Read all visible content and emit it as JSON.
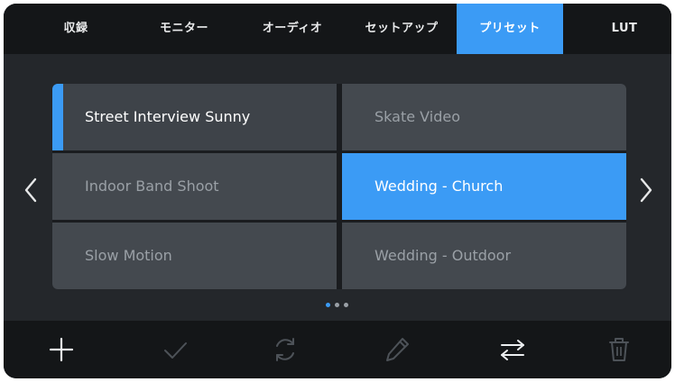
{
  "tabs": [
    {
      "label": "収録"
    },
    {
      "label": "モニター"
    },
    {
      "label": "オーディオ"
    },
    {
      "label": "セットアップ"
    },
    {
      "label": "プリセット"
    },
    {
      "label": "LUT"
    }
  ],
  "active_tab": "プリセット",
  "presets": [
    {
      "name": "Street Interview Sunny"
    },
    {
      "name": "Skate Video"
    },
    {
      "name": "Indoor Band Shoot"
    },
    {
      "name": "Wedding - Church"
    },
    {
      "name": "Slow Motion"
    },
    {
      "name": "Wedding - Outdoor"
    }
  ],
  "pagination": {
    "current": 1,
    "total": 3
  },
  "toolbar": {
    "icons": [
      "plus-icon",
      "check-icon",
      "refresh-icon",
      "pencil-icon",
      "swap-icon",
      "trash-icon"
    ]
  },
  "colors": {
    "accent": "#3b9bf5",
    "background": "#24272b",
    "bar": "#141618",
    "cell": "#44494f"
  }
}
